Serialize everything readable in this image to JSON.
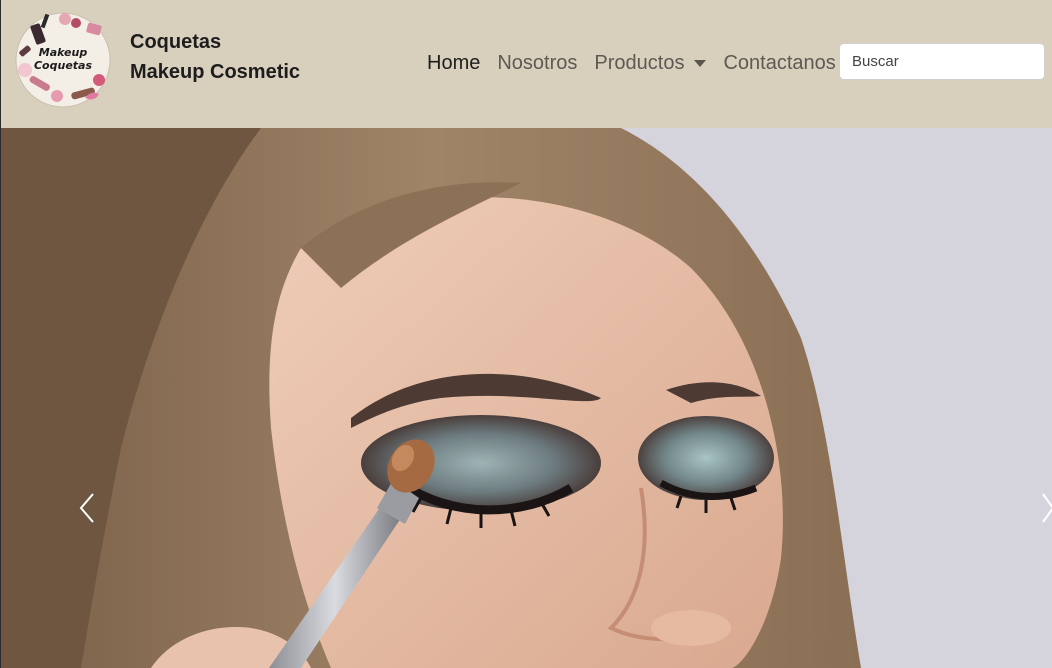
{
  "brand": {
    "logo_text_line1": "Makeup",
    "logo_text_line2": "Coquetas",
    "name_line1": "Coquetas",
    "name_line2": "Makeup Cosmetic"
  },
  "nav": {
    "items": [
      {
        "label": "Home",
        "active": true
      },
      {
        "label": "Nosotros",
        "active": false
      },
      {
        "label": "Productos",
        "active": false,
        "dropdown": true
      },
      {
        "label": "Contactanos",
        "active": false
      }
    ]
  },
  "search": {
    "placeholder": "Buscar",
    "value": ""
  },
  "carousel": {
    "slide_image": "woman-applying-eyeshadow-photo",
    "prev_icon": "chevron-left-icon",
    "next_icon": "chevron-right-icon"
  },
  "colors": {
    "navbar_bg": "#d8cfbd",
    "nav_active": "#1e1e1e",
    "nav_link": "#5e5a52",
    "photo_bg": "#d5d4dc"
  }
}
